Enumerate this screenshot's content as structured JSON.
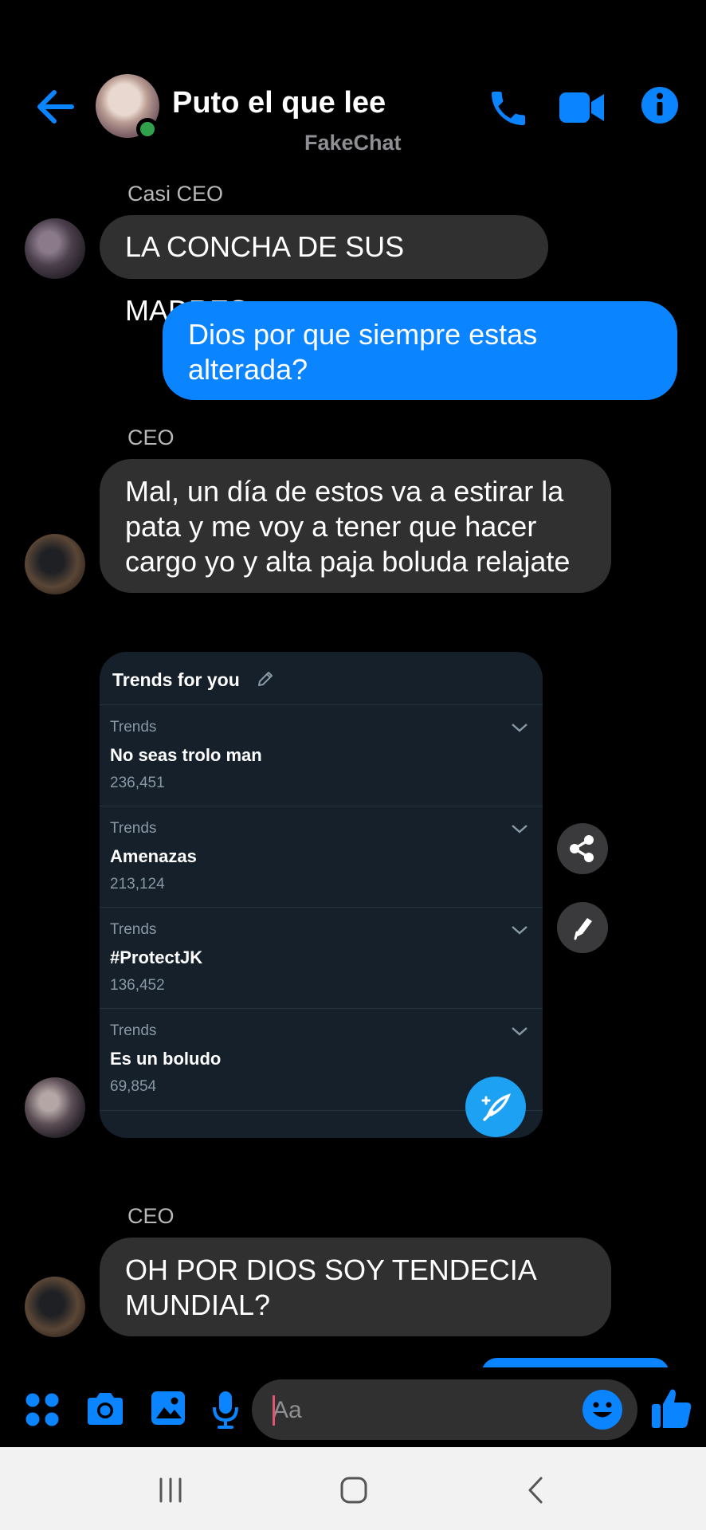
{
  "header": {
    "title": "Puto el que lee",
    "subtitle": "FakeChat",
    "icons": [
      "back-arrow-icon",
      "phone-icon",
      "video-camera-icon",
      "info-icon"
    ],
    "online": true
  },
  "messages": [
    {
      "sender": "Casi CEO",
      "direction": "incoming",
      "text": "LA CONCHA DE SUS MADRES"
    },
    {
      "direction": "outgoing",
      "lines": [
        "Dios por que siempre estas",
        "alterada?"
      ]
    },
    {
      "sender": "CEO",
      "direction": "incoming",
      "lines": [
        "Mal, un día de estos va a estirar la",
        "pata y me voy a tener que hacer",
        "cargo yo y alta paja boluda relajate"
      ]
    },
    {
      "sender": "CEO",
      "direction": "incoming",
      "lines": [
        "OH POR DIOS SOY TENDECIA",
        "MUNDIAL?"
      ]
    }
  ],
  "trends_card": {
    "title": "Trends for you",
    "items": [
      {
        "label": "Trends",
        "name": "No seas trolo man",
        "count": "236,451"
      },
      {
        "label": "Trends",
        "name": "Amenazas",
        "count": "213,124"
      },
      {
        "label": "Trends",
        "name": "#ProtectJK",
        "count": "136,452"
      },
      {
        "label": "Trends",
        "name": "Es un boludo",
        "count": "69,854"
      }
    ]
  },
  "side_actions": [
    "share-icon",
    "pencil-icon"
  ],
  "composer": {
    "placeholder": "Aa",
    "value": "",
    "icons": [
      "apps-grid-icon",
      "camera-icon",
      "gallery-icon",
      "microphone-icon",
      "emoji-icon",
      "thumbs-up-icon"
    ]
  },
  "colors": {
    "accent": "#0a84ff",
    "incoming_bubble": "#303030",
    "online": "#31a24c",
    "trends_bg": "#15202b",
    "twitter_blue": "#1da1f2"
  }
}
